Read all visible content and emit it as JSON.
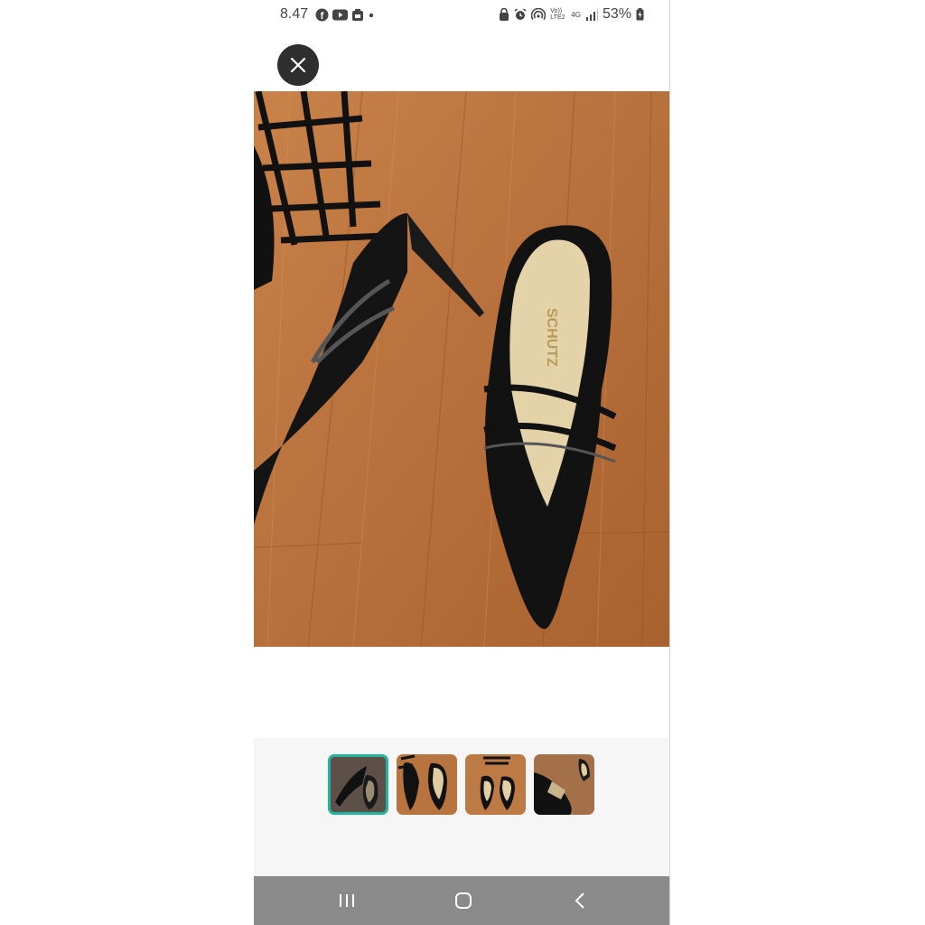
{
  "status_bar": {
    "time": "8.47",
    "battery": "53%",
    "network": "4G",
    "volte": "Vo)) LTE2"
  },
  "viewer": {
    "product_logo_text": "SCHUTZ",
    "selected_index": 0,
    "thumbnails": [
      {
        "label": "thumbnail-1"
      },
      {
        "label": "thumbnail-2"
      },
      {
        "label": "thumbnail-3"
      },
      {
        "label": "thumbnail-4"
      }
    ]
  },
  "colors": {
    "accent": "#21b5a0",
    "close_bg": "#2e2e2e",
    "nav_bg": "#8a8a8a",
    "wood": "#b5703a"
  },
  "icons": {
    "close": "close-icon",
    "recents": "recent-apps-icon",
    "home": "home-icon",
    "back": "back-icon"
  }
}
